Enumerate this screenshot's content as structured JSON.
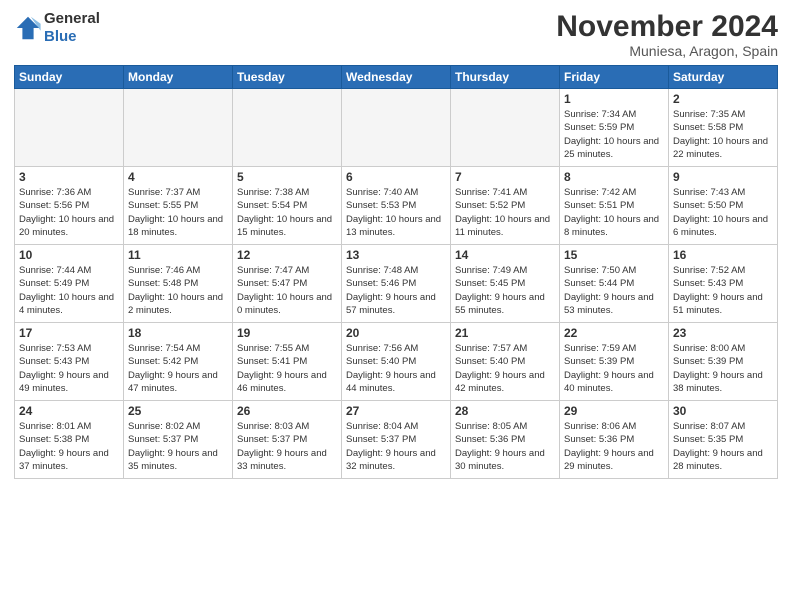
{
  "logo": {
    "line1": "General",
    "line2": "Blue"
  },
  "title": "November 2024",
  "location": "Muniesa, Aragon, Spain",
  "weekdays": [
    "Sunday",
    "Monday",
    "Tuesday",
    "Wednesday",
    "Thursday",
    "Friday",
    "Saturday"
  ],
  "weeks": [
    [
      {
        "day": "",
        "info": ""
      },
      {
        "day": "",
        "info": ""
      },
      {
        "day": "",
        "info": ""
      },
      {
        "day": "",
        "info": ""
      },
      {
        "day": "",
        "info": ""
      },
      {
        "day": "1",
        "info": "Sunrise: 7:34 AM\nSunset: 5:59 PM\nDaylight: 10 hours and 25 minutes."
      },
      {
        "day": "2",
        "info": "Sunrise: 7:35 AM\nSunset: 5:58 PM\nDaylight: 10 hours and 22 minutes."
      }
    ],
    [
      {
        "day": "3",
        "info": "Sunrise: 7:36 AM\nSunset: 5:56 PM\nDaylight: 10 hours and 20 minutes."
      },
      {
        "day": "4",
        "info": "Sunrise: 7:37 AM\nSunset: 5:55 PM\nDaylight: 10 hours and 18 minutes."
      },
      {
        "day": "5",
        "info": "Sunrise: 7:38 AM\nSunset: 5:54 PM\nDaylight: 10 hours and 15 minutes."
      },
      {
        "day": "6",
        "info": "Sunrise: 7:40 AM\nSunset: 5:53 PM\nDaylight: 10 hours and 13 minutes."
      },
      {
        "day": "7",
        "info": "Sunrise: 7:41 AM\nSunset: 5:52 PM\nDaylight: 10 hours and 11 minutes."
      },
      {
        "day": "8",
        "info": "Sunrise: 7:42 AM\nSunset: 5:51 PM\nDaylight: 10 hours and 8 minutes."
      },
      {
        "day": "9",
        "info": "Sunrise: 7:43 AM\nSunset: 5:50 PM\nDaylight: 10 hours and 6 minutes."
      }
    ],
    [
      {
        "day": "10",
        "info": "Sunrise: 7:44 AM\nSunset: 5:49 PM\nDaylight: 10 hours and 4 minutes."
      },
      {
        "day": "11",
        "info": "Sunrise: 7:46 AM\nSunset: 5:48 PM\nDaylight: 10 hours and 2 minutes."
      },
      {
        "day": "12",
        "info": "Sunrise: 7:47 AM\nSunset: 5:47 PM\nDaylight: 10 hours and 0 minutes."
      },
      {
        "day": "13",
        "info": "Sunrise: 7:48 AM\nSunset: 5:46 PM\nDaylight: 9 hours and 57 minutes."
      },
      {
        "day": "14",
        "info": "Sunrise: 7:49 AM\nSunset: 5:45 PM\nDaylight: 9 hours and 55 minutes."
      },
      {
        "day": "15",
        "info": "Sunrise: 7:50 AM\nSunset: 5:44 PM\nDaylight: 9 hours and 53 minutes."
      },
      {
        "day": "16",
        "info": "Sunrise: 7:52 AM\nSunset: 5:43 PM\nDaylight: 9 hours and 51 minutes."
      }
    ],
    [
      {
        "day": "17",
        "info": "Sunrise: 7:53 AM\nSunset: 5:43 PM\nDaylight: 9 hours and 49 minutes."
      },
      {
        "day": "18",
        "info": "Sunrise: 7:54 AM\nSunset: 5:42 PM\nDaylight: 9 hours and 47 minutes."
      },
      {
        "day": "19",
        "info": "Sunrise: 7:55 AM\nSunset: 5:41 PM\nDaylight: 9 hours and 46 minutes."
      },
      {
        "day": "20",
        "info": "Sunrise: 7:56 AM\nSunset: 5:40 PM\nDaylight: 9 hours and 44 minutes."
      },
      {
        "day": "21",
        "info": "Sunrise: 7:57 AM\nSunset: 5:40 PM\nDaylight: 9 hours and 42 minutes."
      },
      {
        "day": "22",
        "info": "Sunrise: 7:59 AM\nSunset: 5:39 PM\nDaylight: 9 hours and 40 minutes."
      },
      {
        "day": "23",
        "info": "Sunrise: 8:00 AM\nSunset: 5:39 PM\nDaylight: 9 hours and 38 minutes."
      }
    ],
    [
      {
        "day": "24",
        "info": "Sunrise: 8:01 AM\nSunset: 5:38 PM\nDaylight: 9 hours and 37 minutes."
      },
      {
        "day": "25",
        "info": "Sunrise: 8:02 AM\nSunset: 5:37 PM\nDaylight: 9 hours and 35 minutes."
      },
      {
        "day": "26",
        "info": "Sunrise: 8:03 AM\nSunset: 5:37 PM\nDaylight: 9 hours and 33 minutes."
      },
      {
        "day": "27",
        "info": "Sunrise: 8:04 AM\nSunset: 5:37 PM\nDaylight: 9 hours and 32 minutes."
      },
      {
        "day": "28",
        "info": "Sunrise: 8:05 AM\nSunset: 5:36 PM\nDaylight: 9 hours and 30 minutes."
      },
      {
        "day": "29",
        "info": "Sunrise: 8:06 AM\nSunset: 5:36 PM\nDaylight: 9 hours and 29 minutes."
      },
      {
        "day": "30",
        "info": "Sunrise: 8:07 AM\nSunset: 5:35 PM\nDaylight: 9 hours and 28 minutes."
      }
    ]
  ]
}
